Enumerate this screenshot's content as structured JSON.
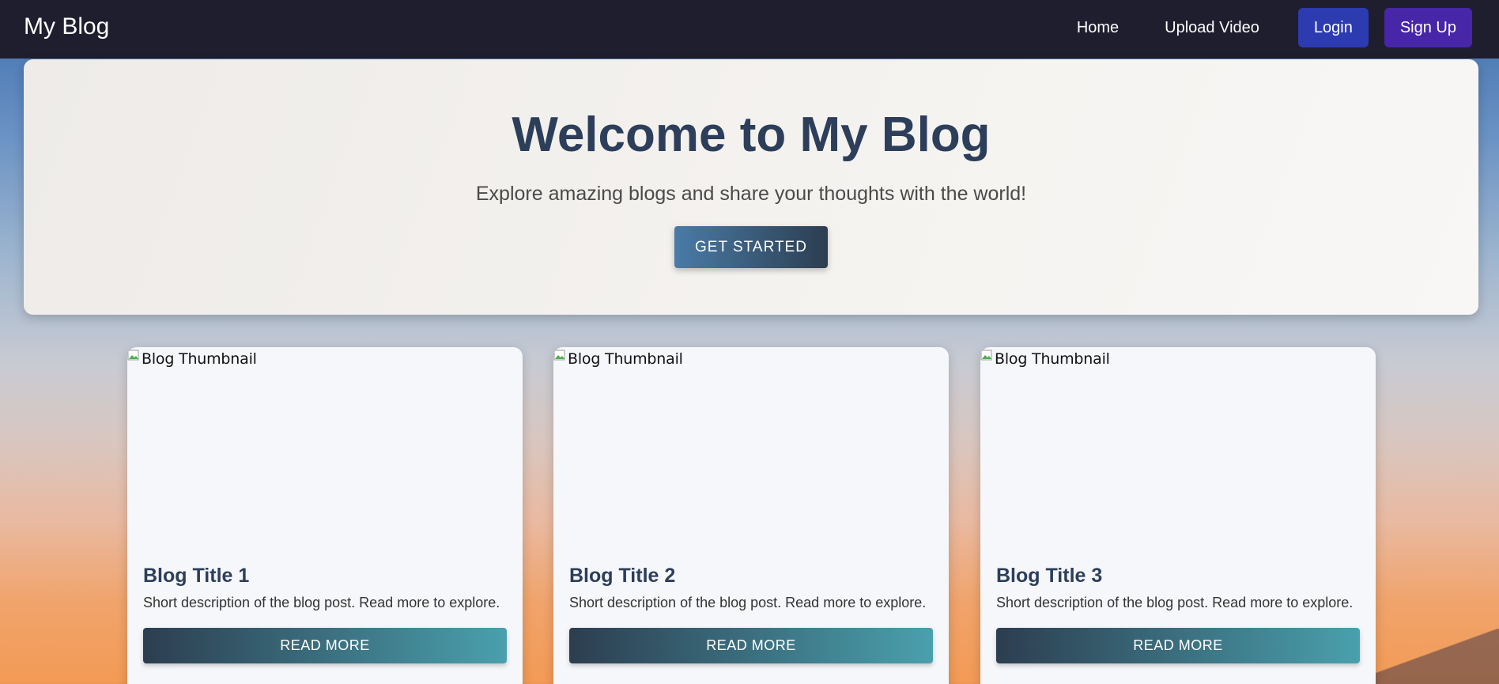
{
  "navbar": {
    "brand": "My Blog",
    "links": {
      "home": "Home",
      "upload": "Upload Video"
    },
    "login_label": "Login",
    "signup_label": "Sign Up"
  },
  "hero": {
    "title": "Welcome to My Blog",
    "subtitle": "Explore amazing blogs and share your thoughts with the world!",
    "cta_label": "GET STARTED"
  },
  "posts": [
    {
      "thumbnail_alt": "Blog Thumbnail",
      "title": "Blog Title 1",
      "description": "Short description of the blog post. Read more to explore.",
      "button_label": "READ MORE"
    },
    {
      "thumbnail_alt": "Blog Thumbnail",
      "title": "Blog Title 2",
      "description": "Short description of the blog post. Read more to explore.",
      "button_label": "READ MORE"
    },
    {
      "thumbnail_alt": "Blog Thumbnail",
      "title": "Blog Title 3",
      "description": "Short description of the blog post. Read more to explore.",
      "button_label": "READ MORE"
    }
  ],
  "icons": {
    "thumbnail": "broken-image-icon"
  },
  "colors": {
    "navbar": "#1e1e2f",
    "login_button": "#2c3bb0",
    "signup_button": "#4826a8",
    "heading": "#2c3e5a"
  }
}
